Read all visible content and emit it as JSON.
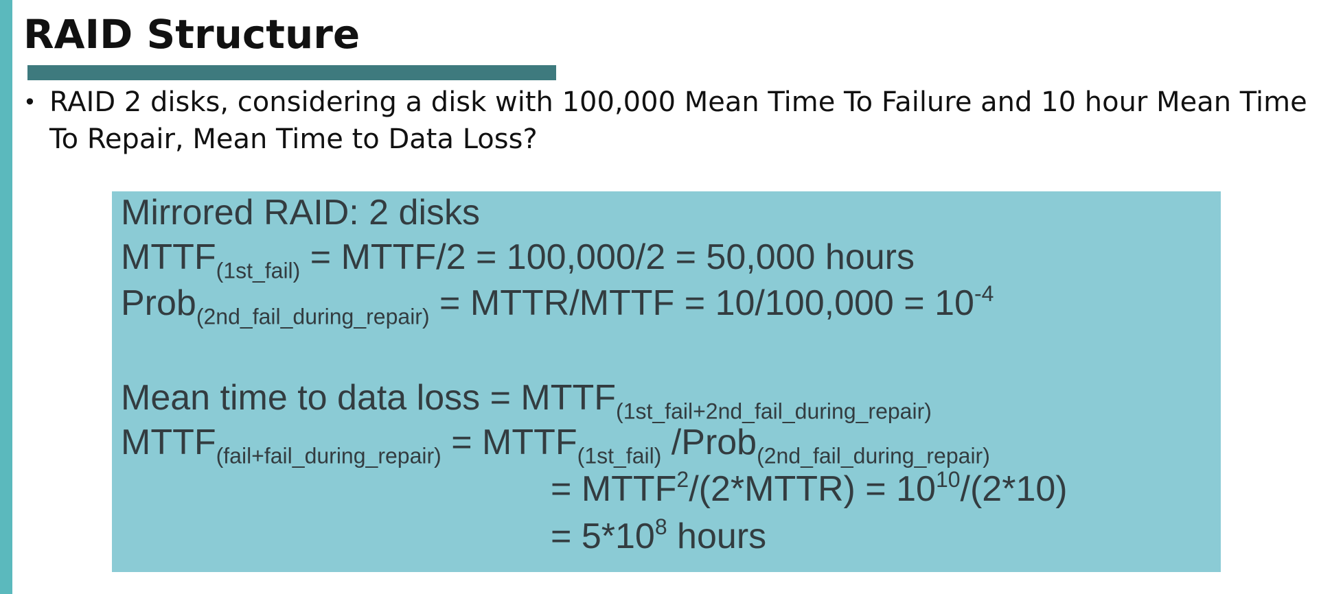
{
  "slide": {
    "title": "RAID Structure",
    "bullet_marker": "•",
    "bullet_text": "RAID 2 disks, considering a disk with 100,000 Mean Time To Failure and 10 hour Mean Time To Repair, Mean Time to Data Loss?"
  },
  "panel": {
    "line1": "Mirrored RAID: 2 disks",
    "line2": {
      "pre": "MTTF",
      "sub": "(1st_fail)",
      "post": " = MTTF/2 = 100,000/2 = 50,000 hours"
    },
    "line3": {
      "pre": "Prob",
      "sub": "(2nd_fail_during_repair)",
      "post": " = MTTR/MTTF = 10/100,000 = 10",
      "sup": "-4"
    },
    "line4": {
      "pre": "Mean time to data loss = MTTF",
      "sub": "(1st_fail+2nd_fail_during_repair)"
    },
    "line5": {
      "pre": "MTTF",
      "sub1": "(fail+fail_during_repair)",
      "mid1": " = MTTF",
      "sub2": "(1st_fail)",
      "mid2": " /Prob",
      "sub3": "(2nd_fail_during_repair)"
    },
    "line6": {
      "pre": "= MTTF",
      "sup1": "2",
      "mid": "/(2*MTTR) = 10",
      "sup2": "10",
      "post": "/(2*10)"
    },
    "line7": {
      "pre": "= 5*10",
      "sup": "8",
      "post": " hours"
    }
  },
  "colors": {
    "side_bar": "#5bb9bd",
    "title_rule": "#3e7a7e",
    "panel_background": "#8bcbd5",
    "panel_text": "#333c40"
  }
}
